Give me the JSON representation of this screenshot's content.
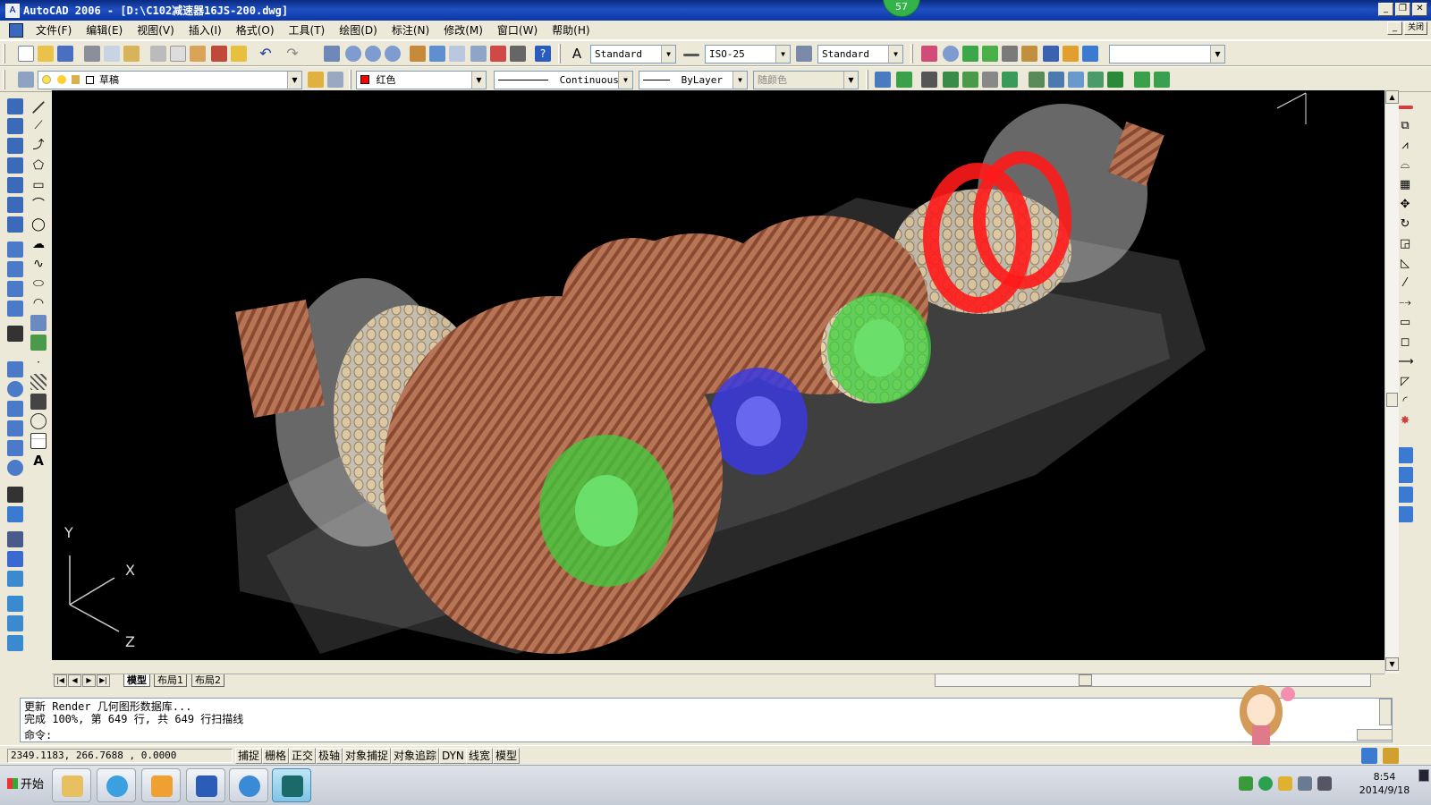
{
  "window": {
    "title": "AutoCAD 2006 - [D:\\C102减速器16JS-200.dwg]",
    "badge": "57",
    "close_tip": "关闭"
  },
  "menu": [
    "文件(F)",
    "编辑(E)",
    "视图(V)",
    "插入(I)",
    "格式(O)",
    "工具(T)",
    "绘图(D)",
    "标注(N)",
    "修改(M)",
    "窗口(W)",
    "帮助(H)"
  ],
  "toolbar1": {
    "text_style": "Standard",
    "dim_style": "ISO-25",
    "table_style": "Standard",
    "extra_combo": ""
  },
  "toolbar2": {
    "layer": "草稿",
    "color": "红色",
    "linetype": "Continuous",
    "lineweight": "ByLayer",
    "plotstyle": "随颜色"
  },
  "colors": {
    "color_swatch": "#ff0000",
    "viewport_bg": "#000000",
    "gear_copper": "#b86a4a",
    "bearing_green": "#3ccf3c",
    "bearing_blue": "#3a3adf",
    "bearing_red": "#ff1a1a"
  },
  "viewport": {
    "ucs_y": "Y",
    "ucs_x": "X",
    "ucs_z": "Z"
  },
  "tabs": [
    "模型",
    "布局1",
    "布局2"
  ],
  "command": {
    "line1": "更新 Render 几何图形数据库...",
    "line2": "完成 100%, 第 649 行, 共 649 行扫描线",
    "prompt": "命令:"
  },
  "status": {
    "coords": "2349.1183, 266.7688 , 0.0000",
    "toggles": [
      "捕捉",
      "栅格",
      "正交",
      "极轴",
      "对象捕捉",
      "对象追踪",
      "DYN",
      "线宽",
      "模型"
    ]
  },
  "taskbar": {
    "start": "开始",
    "time": "8:54",
    "date": "2014/9/18"
  }
}
